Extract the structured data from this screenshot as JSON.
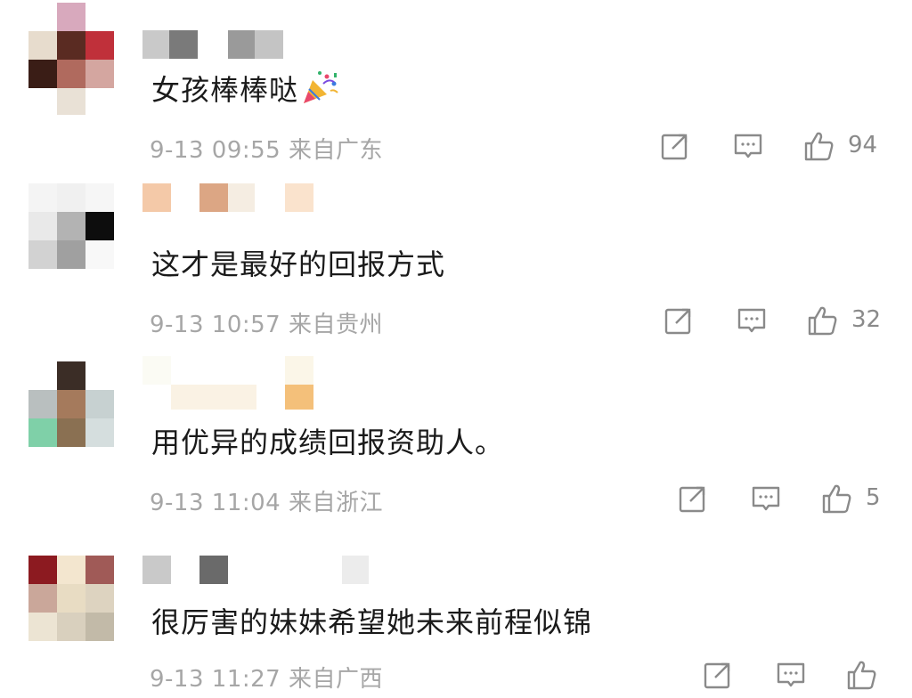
{
  "comments": [
    {
      "text": "女孩棒棒哒",
      "emoji": "party-popper",
      "date": "9-13",
      "time": "09:55",
      "location": "来自广东",
      "likes": "94"
    },
    {
      "text": "这才是最好的回报方式",
      "date": "9-13",
      "time": "10:57",
      "location": "来自贵州",
      "likes": "32"
    },
    {
      "text": "用优异的成绩回报资助人。",
      "date": "9-13",
      "time": "11:04",
      "location": "来自浙江",
      "likes": "5"
    },
    {
      "text": "很厉害的妹妹希望她未来前程似锦",
      "date": "9-13",
      "time": "11:27",
      "location": "来自广西",
      "likes": ""
    }
  ],
  "icons": {
    "share": "share-icon",
    "reply": "comment-icon",
    "like": "thumbs-up-icon"
  },
  "colors": {
    "text": "#1a1a1a",
    "meta": "#a6a6a6",
    "icon": "#8a8a8a"
  }
}
